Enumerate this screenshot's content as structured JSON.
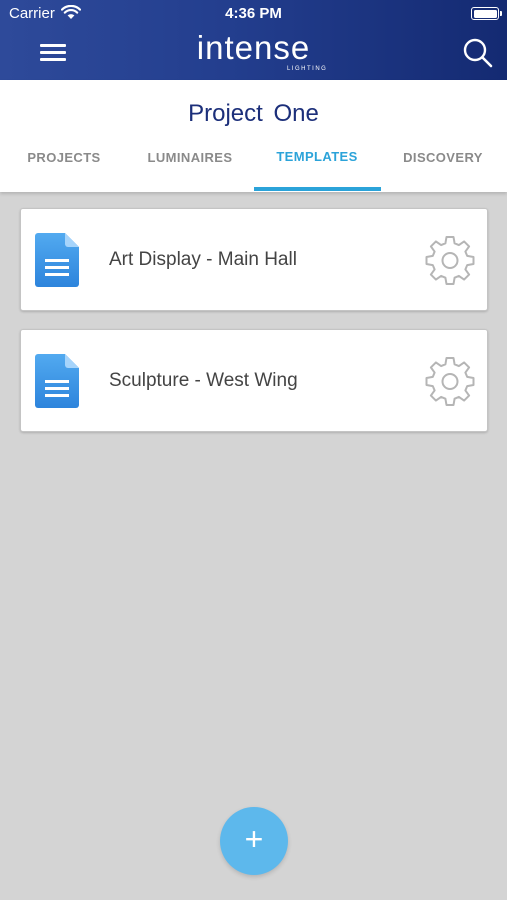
{
  "status_bar": {
    "carrier": "Carrier",
    "time": "4:36 PM"
  },
  "app": {
    "logo_text": "intense",
    "logo_subtext": "LIGHTING"
  },
  "header": {
    "project_title": "Project One",
    "tabs": [
      {
        "label": "PROJECTS",
        "active": false
      },
      {
        "label": "LUMINAIRES",
        "active": false
      },
      {
        "label": "TEMPLATES",
        "active": true
      },
      {
        "label": "DISCOVERY",
        "active": false
      }
    ]
  },
  "templates": [
    {
      "name": "Art Display - Main Hall",
      "icon": "document-icon",
      "action_icon": "gear-icon"
    },
    {
      "name": "Sculpture - West Wing",
      "icon": "document-icon",
      "action_icon": "gear-icon"
    }
  ],
  "fab": {
    "label": "+",
    "icon": "add-icon"
  },
  "colors": {
    "nav_bar_start": "#2e4a9a",
    "nav_bar_end": "#142a72",
    "title_blue": "#1c2f7a",
    "accent": "#2ba3d9",
    "fab": "#5db8ec",
    "background": "#d4d4d4"
  }
}
